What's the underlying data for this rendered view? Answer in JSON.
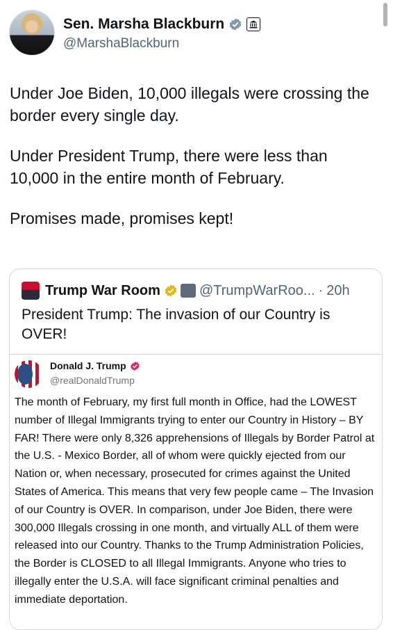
{
  "author": {
    "display_name": "Sen. Marsha Blackburn",
    "handle": "@MarshaBlackburn",
    "verified_badge_color": "#829aab",
    "avatar_icon": "profile-photo",
    "affiliation_icon": "government-building-icon"
  },
  "tweet": {
    "paragraphs": [
      "Under Joe Biden, 10,000 illegals were crossing the border every single day.",
      "Under President Trump, there were less than 10,000 in the entire month of February.",
      "Promises made, promises kept!"
    ]
  },
  "quote": {
    "display_name": "Trump War Room",
    "handle": "@TrumpWarRoo...",
    "separator": "·",
    "time": "20h",
    "verified_badge_color": "#e2b719",
    "text": "President Trump: The invasion of our Country is OVER!"
  },
  "embedded_post": {
    "display_name": "Donald J. Trump",
    "handle": "@realDonaldTrump",
    "verified_badge_color": "#e0245e",
    "body": "The month of February, my first full month in Office, had the LOWEST number of Illegal Immigrants trying to enter our Country in History – BY FAR! There were only 8,326 apprehensions of Illegals by Border Patrol at the U.S. - Mexico Border, all of whom were quickly ejected from our Nation or, when necessary, prosecuted for crimes against the United States of America. This means that very few people came – The Invasion of our Country is OVER. In comparison, under Joe Biden, there were 300,000 Illegals crossing in one month, and virtually ALL of them were released into our Country. Thanks to the Trump Administration Policies, the Border is CLOSED to all Illegal Immigrants. Anyone who tries to illegally enter the U.S.A. will face significant criminal penalties and immediate deportation."
  }
}
